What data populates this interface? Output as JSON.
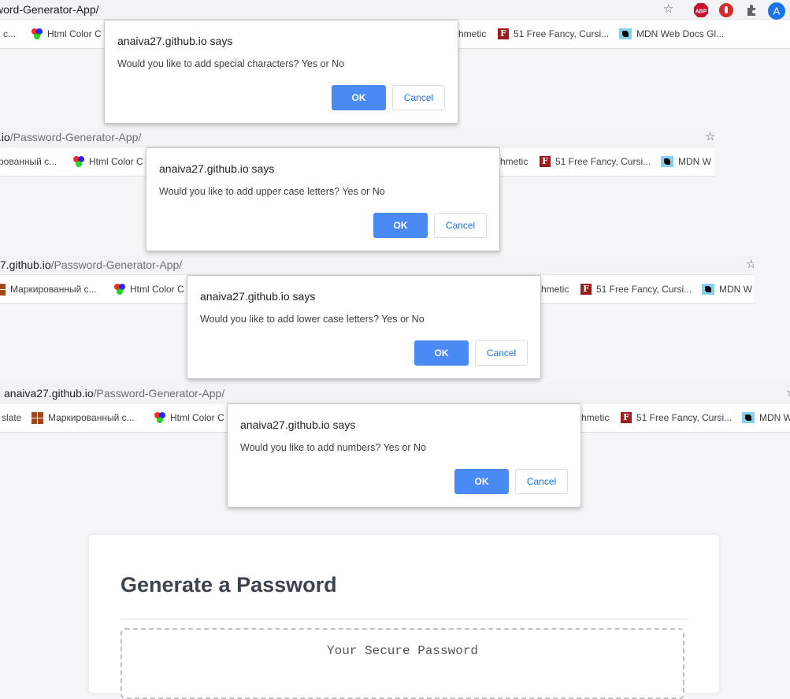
{
  "browser": {
    "url_host_1": "word-Generator-App/",
    "url_host_2": ".io",
    "url_path_2": "/Password-Generator-App/",
    "url_host_3": "7.github.io",
    "url_path_3": "/Password-Generator-App/",
    "url_host_4": "anaiva27.github.io",
    "url_path_4": "/Password-Generator-App/",
    "star_icon": "☆",
    "abp_label": "ABP",
    "avatar_letter": "A"
  },
  "bookmarks": {
    "frag_c": "i c...",
    "marked": "Маркированный с...",
    "marked_trunc": "рованный с...",
    "htmlcolor": "Html Color C",
    "arithmetic": "hmetic",
    "fancy": "51 Free Fancy, Cursi...",
    "mdn": "MDN Web Docs Gl...",
    "mdn_short": "MDN W",
    "slate": "slate",
    "fav_f": "F"
  },
  "dialogs": [
    {
      "title": "anaiva27.github.io says",
      "message": "Would you like to add special characters? Yes or No",
      "ok": "OK",
      "cancel": "Cancel"
    },
    {
      "title": "anaiva27.github.io says",
      "message": "Would you like to add upper case letters? Yes or No",
      "ok": "OK",
      "cancel": "Cancel"
    },
    {
      "title": "anaiva27.github.io says",
      "message": "Would you like to add lower case letters? Yes or No",
      "ok": "OK",
      "cancel": "Cancel"
    },
    {
      "title": "anaiva27.github.io says",
      "message": "Would you like to add numbers? Yes or No",
      "ok": "OK",
      "cancel": "Cancel"
    }
  ],
  "app": {
    "heading": "Generate a Password",
    "password_placeholder": "Your Secure Password"
  }
}
